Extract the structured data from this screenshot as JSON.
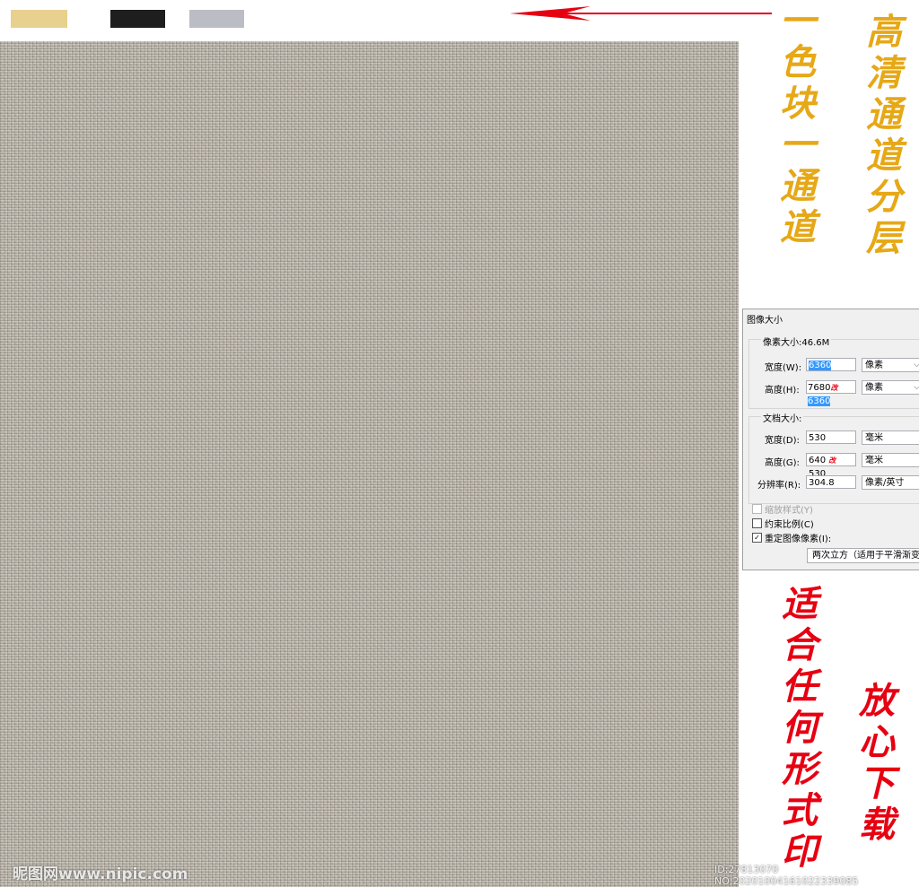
{
  "swatches": {
    "colors": [
      "#e8d08e",
      "#1e1e1e",
      "#babec4"
    ]
  },
  "side_text": {
    "col1": "一色块一通道",
    "col2": "高清通道分层",
    "col3": "适合任何形式印",
    "col4": "放心下载"
  },
  "dialog": {
    "title": "图像大小",
    "pixel_dimensions_label": "像素大小:46.6M",
    "width_label": "宽度(W):",
    "width_value": "6360",
    "width_unit": "像素",
    "height_label": "高度(H):",
    "height_value_old": "7680",
    "height_mark": "改",
    "height_value_new": "6360",
    "height_unit": "像素",
    "document_size_label": "文档大小:",
    "doc_width_label": "宽度(D):",
    "doc_width_value": "530",
    "doc_width_unit": "毫米",
    "doc_height_label": "高度(G):",
    "doc_height_value_old": "640",
    "doc_height_mark": "改",
    "doc_height_value_new": "530",
    "doc_height_unit": "毫米",
    "resolution_label": "分辨率(R):",
    "resolution_value": "304.8",
    "resolution_unit": "像素/英寸",
    "scale_styles_label": "缩放样式(Y)",
    "constrain_label": "约束比例(C)",
    "resample_label": "重定图像像素(I):",
    "resample_method": "两次立方（适用于平滑渐变"
  },
  "watermarks": {
    "left": "昵图网www.nipic.com",
    "right": "ID:27813070 NO:20201004161022339085"
  },
  "colors": {
    "arrow": "#e60012",
    "gold_text": "#e6a817",
    "red_text": "#e60012",
    "texture": "#b9b3a8"
  }
}
